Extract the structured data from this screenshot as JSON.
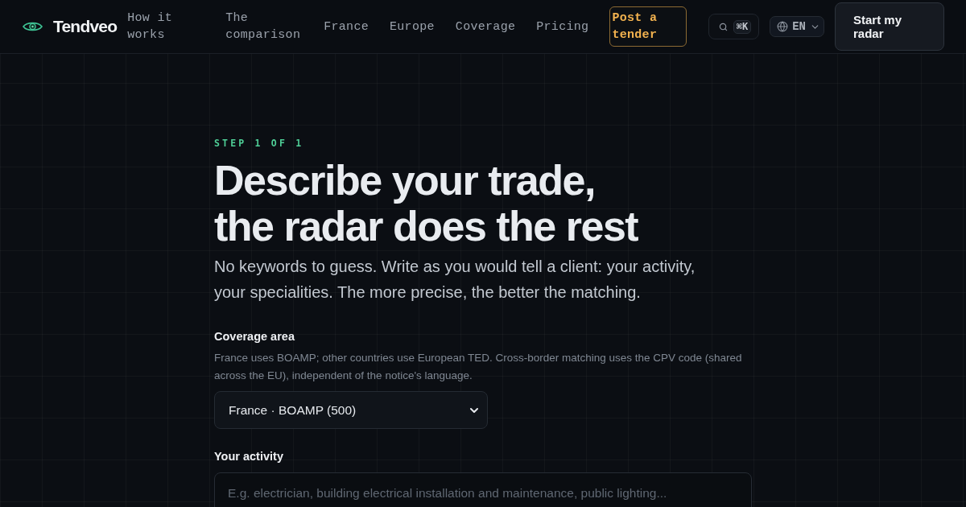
{
  "header": {
    "brand": "Tendveo",
    "nav": [
      {
        "label": "How it works"
      },
      {
        "label": "The comparison"
      },
      {
        "label": "France"
      },
      {
        "label": "Europe"
      },
      {
        "label": "Coverage"
      },
      {
        "label": "Pricing"
      }
    ],
    "post_button": "Post a tender",
    "search": {
      "shortcut": "⌘K"
    },
    "language": "EN",
    "cta": "Start my radar"
  },
  "form": {
    "step": "STEP 1 OF 1",
    "title_lines": [
      "Describe your trade,",
      "the radar does the rest"
    ],
    "intro": "No keywords to guess. Write as you would tell a client: your activity, your specialities. The more precise, the better the matching.",
    "fields": [
      {
        "kind": "select",
        "label": "Coverage area",
        "hint": "France uses BOAMP; other countries use European TED. Cross-border matching uses the CPV code (shared across the EU), independent of the notice's language.",
        "value": "France · BOAMP (500)"
      },
      {
        "kind": "textarea",
        "label": "Your activity",
        "placeholder": "E.g. electrician, building electrical installation and maintenance, public lighting..."
      }
    ]
  }
}
